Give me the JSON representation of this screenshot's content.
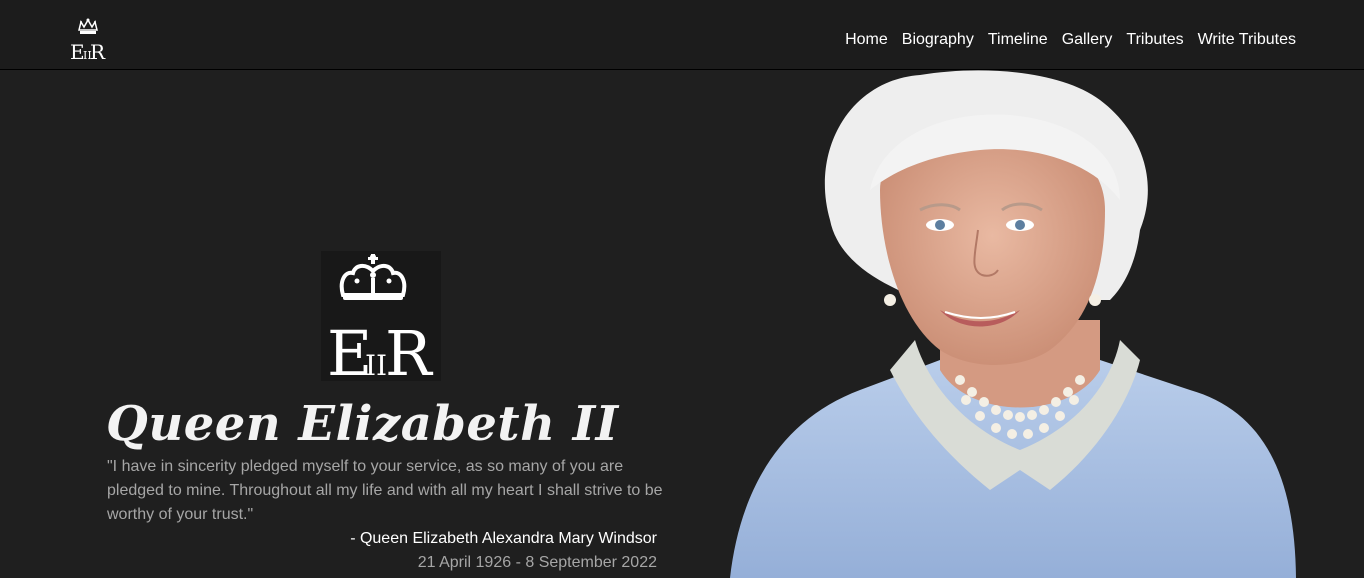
{
  "nav": {
    "logo_text": "EIIR",
    "links": [
      "Home",
      "Biography",
      "Timeline",
      "Gallery",
      "Tributes",
      "Write Tributes"
    ]
  },
  "hero": {
    "emblem_text": "EIIR",
    "title": "Queen Elizabeth II",
    "quote": "\"I have in sincerity pledged myself to your service, as so many of you are pledged to mine. Throughout all my life and with all my heart I shall strive to be worthy of your trust.\"",
    "attribution": "- Queen Elizabeth Alexandra Mary Windsor",
    "dates": "21 April 1926 - 8 September 2022"
  },
  "colors": {
    "background": "#1f1f1f",
    "nav_background": "#1c1c1c",
    "text_primary": "#ffffff",
    "text_muted": "#a6a6a6",
    "dress": "#a9c2e6"
  },
  "icons": {
    "logo": "royal-cypher-crown-icon",
    "emblem": "royal-cypher-crown-icon"
  }
}
